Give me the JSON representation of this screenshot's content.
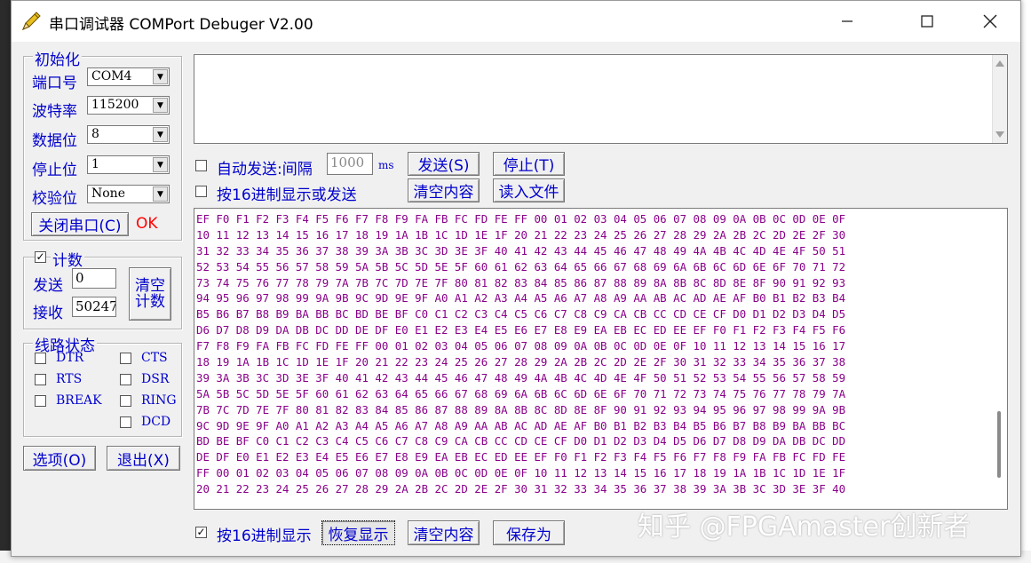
{
  "window": {
    "title": "串口调试器 COMPort Debuger V2.00",
    "minimize_icon": "minimize-icon",
    "maximize_icon": "maximize-icon",
    "close_icon": "close-icon"
  },
  "init_group": {
    "title": "初始化",
    "port": {
      "label": "端口号",
      "value": "COM4"
    },
    "baud": {
      "label": "波特率",
      "value": "115200"
    },
    "databits": {
      "label": "数据位",
      "value": "8"
    },
    "stopbits": {
      "label": "停止位",
      "value": "1"
    },
    "parity": {
      "label": "校验位",
      "value": "None"
    },
    "close_port_button": "关闭串口(C)",
    "status": "OK"
  },
  "count_group": {
    "title": "计数",
    "checked": true,
    "send_label": "发送",
    "send_value": "0",
    "recv_label": "接收",
    "recv_value": "502478",
    "clear_button_line1": "清空",
    "clear_button_line2": "计数"
  },
  "line_status": {
    "title": "线路状态",
    "signals": [
      "DTR",
      "CTS",
      "RTS",
      "DSR",
      "BREAK",
      "RING",
      "DCD"
    ]
  },
  "bottom_left": {
    "options_button": "选项(O)",
    "exit_button": "退出(X)"
  },
  "send_panel": {
    "auto_send_label": "自动发送:间隔",
    "interval_value": "1000",
    "interval_unit": "ms",
    "hex_send_label": "按16进制显示或发送",
    "send_button": "发送(S)",
    "stop_button": "停止(T)",
    "clear_button": "清空内容",
    "read_file_button": "读入文件"
  },
  "recv_panel": {
    "lines": [
      "EF F0 F1 F2 F3 F4 F5 F6 F7 F8 F9 FA FB FC FD FE FF 00 01 02 03 04 05 06 07 08 09 0A 0B 0C 0D 0E 0F",
      "10 11 12 13 14 15 16 17 18 19 1A 1B 1C 1D 1E 1F 20 21 22 23 24 25 26 27 28 29 2A 2B 2C 2D 2E 2F 30",
      "31 32 33 34 35 36 37 38 39 3A 3B 3C 3D 3E 3F 40 41 42 43 44 45 46 47 48 49 4A 4B 4C 4D 4E 4F 50 51",
      "52 53 54 55 56 57 58 59 5A 5B 5C 5D 5E 5F 60 61 62 63 64 65 66 67 68 69 6A 6B 6C 6D 6E 6F 70 71 72",
      "73 74 75 76 77 78 79 7A 7B 7C 7D 7E 7F 80 81 82 83 84 85 86 87 88 89 8A 8B 8C 8D 8E 8F 90 91 92 93",
      "94 95 96 97 98 99 9A 9B 9C 9D 9E 9F A0 A1 A2 A3 A4 A5 A6 A7 A8 A9 AA AB AC AD AE AF B0 B1 B2 B3 B4",
      "B5 B6 B7 B8 B9 BA BB BC BD BE BF C0 C1 C2 C3 C4 C5 C6 C7 C8 C9 CA CB CC CD CE CF D0 D1 D2 D3 D4 D5",
      "D6 D7 D8 D9 DA DB DC DD DE DF E0 E1 E2 E3 E4 E5 E6 E7 E8 E9 EA EB EC ED EE EF F0 F1 F2 F3 F4 F5 F6",
      "F7 F8 F9 FA FB FC FD FE FF 00 01 02 03 04 05 06 07 08 09 0A 0B 0C 0D 0E 0F 10 11 12 13 14 15 16 17",
      "18 19 1A 1B 1C 1D 1E 1F 20 21 22 23 24 25 26 27 28 29 2A 2B 2C 2D 2E 2F 30 31 32 33 34 35 36 37 38",
      "39 3A 3B 3C 3D 3E 3F 40 41 42 43 44 45 46 47 48 49 4A 4B 4C 4D 4E 4F 50 51 52 53 54 55 56 57 58 59",
      "5A 5B 5C 5D 5E 5F 60 61 62 63 64 65 66 67 68 69 6A 6B 6C 6D 6E 6F 70 71 72 73 74 75 76 77 78 79 7A",
      "7B 7C 7D 7E 7F 80 81 82 83 84 85 86 87 88 89 8A 8B 8C 8D 8E 8F 90 91 92 93 94 95 96 97 98 99 9A 9B",
      "9C 9D 9E 9F A0 A1 A2 A3 A4 A5 A6 A7 A8 A9 AA AB AC AD AE AF B0 B1 B2 B3 B4 B5 B6 B7 B8 B9 BA BB BC",
      "BD BE BF C0 C1 C2 C3 C4 C5 C6 C7 C8 C9 CA CB CC CD CE CF D0 D1 D2 D3 D4 D5 D6 D7 D8 D9 DA DB DC DD",
      "DE DF E0 E1 E2 E3 E4 E5 E6 E7 E8 E9 EA EB EC ED EE EF F0 F1 F2 F3 F4 F5 F6 F7 F8 F9 FA FB FC FD FE",
      "FF 00 01 02 03 04 05 06 07 08 09 0A 0B 0C 0D 0E 0F 10 11 12 13 14 15 16 17 18 19 1A 1B 1C 1D 1E 1F",
      "20 21 22 23 24 25 26 27 28 29 2A 2B 2C 2D 2E 2F 30 31 32 33 34 35 36 37 38 39 3A 3B 3C 3D 3E 3F 40"
    ],
    "hex_display_label": "按16进制显示",
    "hex_display_checked": true,
    "resume_button": "恢复显示",
    "clear_button": "清空内容",
    "save_button": "保存为"
  },
  "watermark": "知乎 @FPGAmaster创新者",
  "colors": {
    "label_blue": "#0000cc",
    "hex_text": "#880088",
    "ok_red": "#ff0000"
  }
}
